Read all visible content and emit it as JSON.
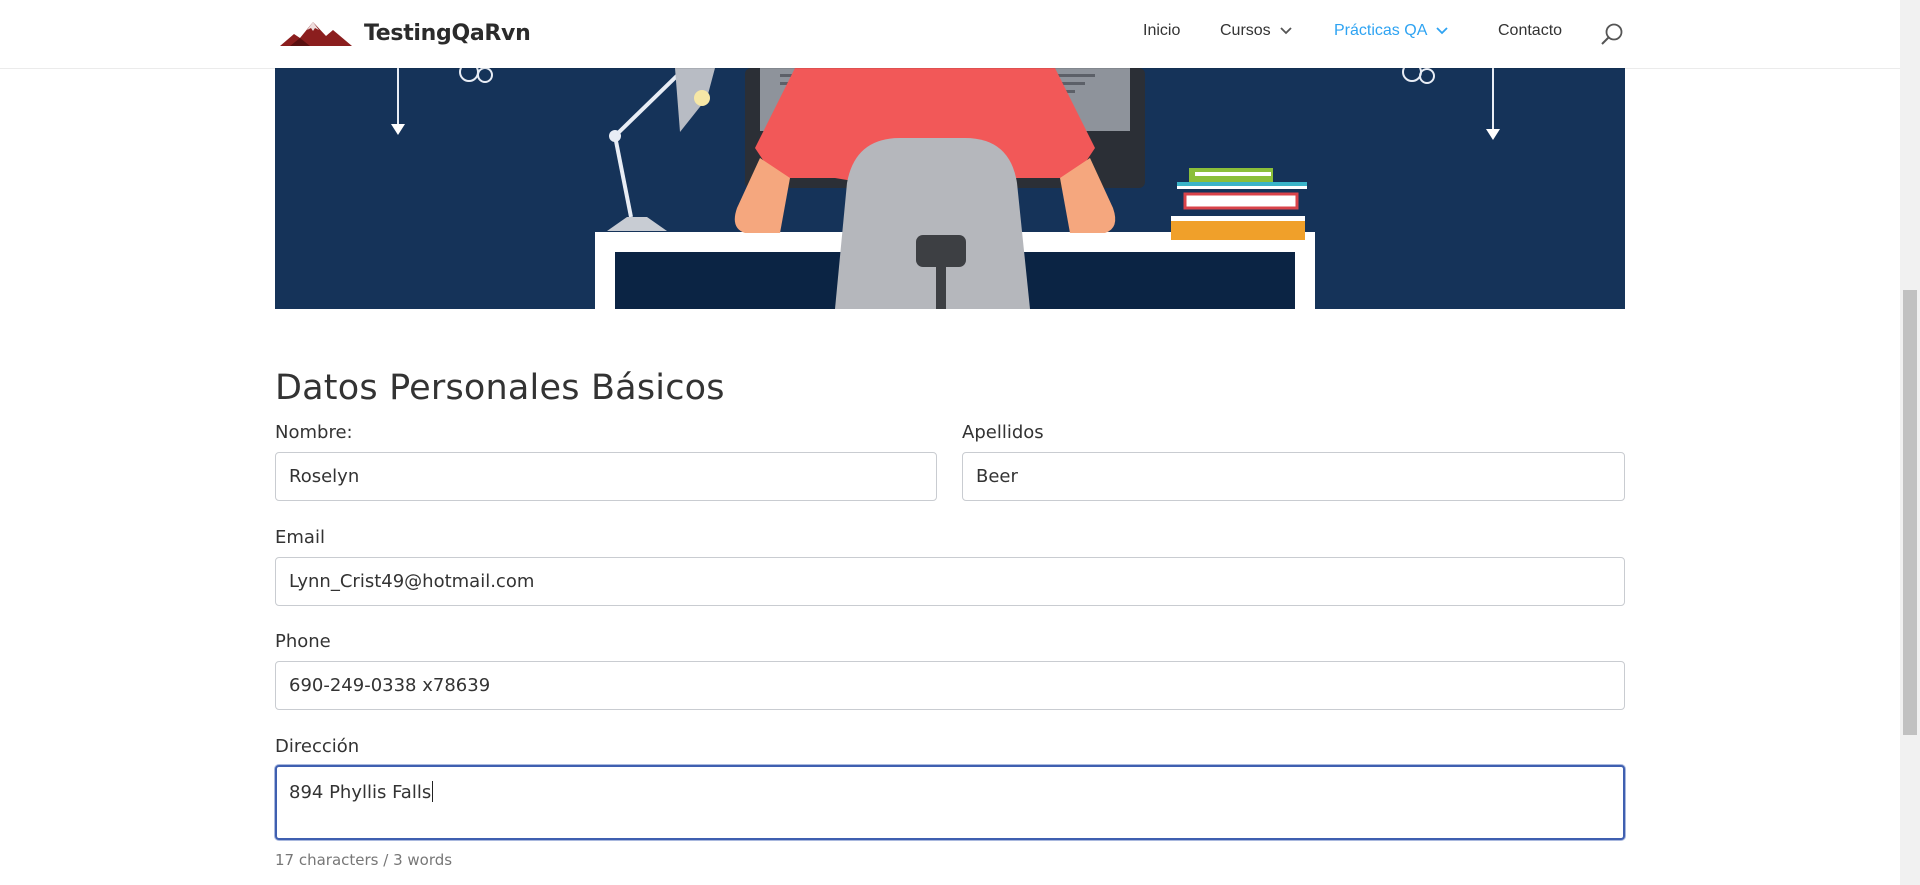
{
  "header": {
    "logo_text": "TestingQaRvn",
    "nav": [
      {
        "label": "Inicio",
        "dropdown": false,
        "active": false
      },
      {
        "label": "Cursos",
        "dropdown": true,
        "active": false
      },
      {
        "label": "Prácticas QA",
        "dropdown": true,
        "active": true
      },
      {
        "label": "Contacto",
        "dropdown": false,
        "active": false
      }
    ],
    "search_icon": "search-icon",
    "accent_color": "#2ea3f2"
  },
  "banner": {
    "background_color": "#153359"
  },
  "form": {
    "section_title": "Datos Personales Básicos",
    "nombre": {
      "label": "Nombre:",
      "value": "Roselyn"
    },
    "apellidos": {
      "label": "Apellidos",
      "value": "Beer"
    },
    "email": {
      "label": "Email",
      "value": "Lynn_Crist49@hotmail.com"
    },
    "phone": {
      "label": "Phone",
      "value": "690-249-0338 x78639"
    },
    "direccion": {
      "label": "Dirección",
      "value": "894 Phyllis Falls"
    },
    "counter": "17 characters / 3 words"
  }
}
